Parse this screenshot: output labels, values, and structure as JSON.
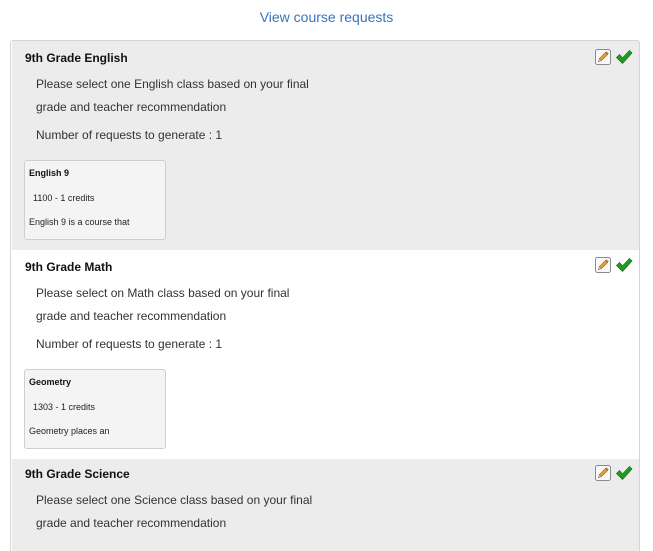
{
  "header": {
    "view_requests_label": "View course requests"
  },
  "colors": {
    "link": "#3a74b8",
    "shaded_row": "#ececec",
    "check_green": "#1f9d1f",
    "pencil_orange": "#e8a23a"
  },
  "icons": {
    "edit": "pencil-edit-icon",
    "complete": "green-check-icon"
  },
  "count_label": "Number of requests to generate :",
  "sections": [
    {
      "title": "9th Grade English",
      "description_line1": "Please select one English class based on your final",
      "description_line2": "grade and teacher recommendation",
      "request_count": "Number of requests to generate : 1",
      "course": {
        "name": "English 9",
        "number_credits": "1100 - 1 credits",
        "description": "English 9 is a course that"
      }
    },
    {
      "title": "9th Grade Math",
      "description_line1": "Please select on Math class based on your final",
      "description_line2": "grade and teacher recommendation",
      "request_count": "Number of requests to generate : 1",
      "course": {
        "name": "Geometry",
        "number_credits": "1303 - 1 credits",
        "description": "Geometry places an"
      }
    },
    {
      "title": "9th Grade Science",
      "description_line1": "Please select one Science class based on your final",
      "description_line2": "grade and teacher recommendation"
    }
  ]
}
